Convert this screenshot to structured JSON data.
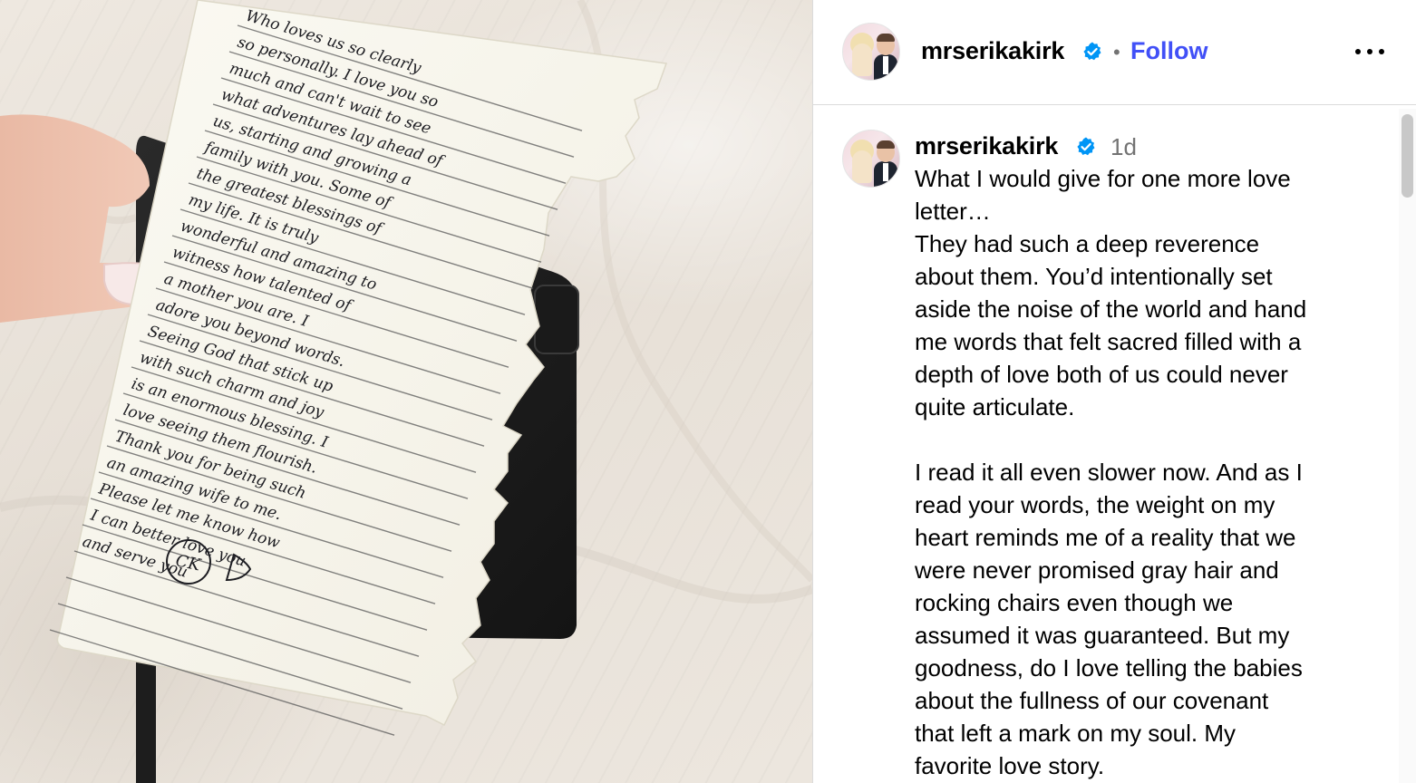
{
  "post": {
    "header": {
      "username": "mrserikakirk",
      "separator": "•",
      "follow_label": "Follow",
      "verified_icon": "verified-badge-icon",
      "more_icon": "more-options-icon"
    },
    "caption": {
      "username": "mrserikakirk",
      "timestamp": "1d",
      "lines": [
        "What I would give for one more love",
        "letter…",
        "They had such a deep reverence",
        "about them. You’d intentionally set",
        "aside the noise of the world and hand",
        "me words that felt sacred filled with a",
        "depth of love both of us could never",
        "quite articulate.",
        "",
        "I read it all even slower now. And as I",
        "read your words, the weight on my",
        "heart reminds me of a reality that we",
        "were never promised gray hair and",
        "rocking chairs even though we",
        "assumed it was guaranteed. But my",
        "goodness, do I love telling the babies",
        "about the fullness of our covenant",
        "that left a mark on my soul. My",
        "favorite love story."
      ]
    },
    "colors": {
      "follow": "#4150f7",
      "verified": "#0095f6",
      "secondary_text": "#737373",
      "divider": "#dbdbdb"
    }
  },
  "letter": {
    "handwriting": [
      "Who loves us so clearly",
      "so personally. I love you so",
      "much and can't wait to see",
      "what adventures lay ahead of",
      "us, starting and growing a",
      "family with you. Some of",
      "the greatest blessings of",
      "my life. It is truly",
      "wonderful and amazing to",
      "witness how talented of",
      "a mother you are. I",
      "adore you beyond words.",
      "Seeing God that stick up",
      "with such charm and joy",
      "is an enormous blessing. I",
      "love seeing them flourish.",
      "Thank you for being such",
      "an amazing wife to me.",
      "Please let me know how",
      "I can better love you",
      "and serve you"
    ],
    "signature": "CK"
  }
}
